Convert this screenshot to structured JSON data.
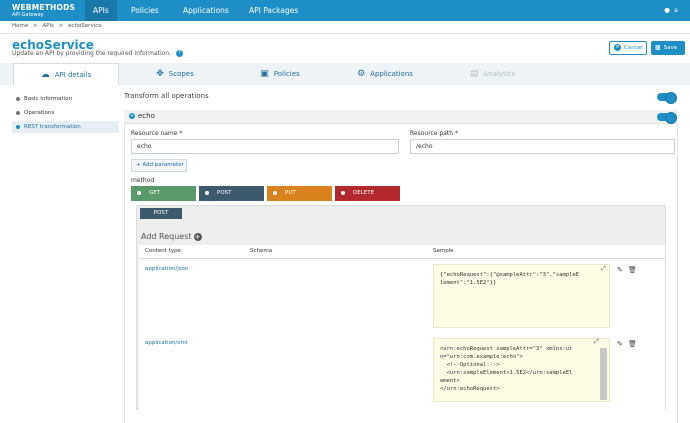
{
  "brand": {
    "name": "WEBMETHODS",
    "sub": "API Gateway"
  },
  "nav": [
    {
      "label": "APIs"
    },
    {
      "label": "Policies"
    },
    {
      "label": "Applications"
    },
    {
      "label": "API Packages"
    }
  ],
  "user": {
    "name": "a",
    "icon": "user-icon"
  },
  "breadcrumb": [
    "Home",
    ">",
    "APIs",
    ">",
    "echoService"
  ],
  "page": {
    "title": "echoService",
    "subtitle": "Update an API by providing the required information.",
    "cancel_label": "Cancel",
    "save_label": "Save"
  },
  "tabs": [
    {
      "label": "API details",
      "icon": "cloud-icon"
    },
    {
      "label": "Scopes",
      "icon": "scopes-icon"
    },
    {
      "label": "Policies",
      "icon": "lock-icon"
    },
    {
      "label": "Applications",
      "icon": "gears-icon"
    },
    {
      "label": "Analytics",
      "icon": "chart-icon"
    }
  ],
  "sidebar": [
    {
      "label": "Basic information"
    },
    {
      "label": "Operations"
    },
    {
      "label": "REST transformation"
    }
  ],
  "transform": {
    "label": "Transform all operations"
  },
  "resource": {
    "name": "echo",
    "name_label": "Resource name *",
    "name_value": "echo",
    "path_label": "Resource path *",
    "path_value": "/echo",
    "add_param_label": "Add parameter",
    "method_label": "method"
  },
  "methods": [
    {
      "label": "GET",
      "color": "#5a9a6a"
    },
    {
      "label": "POST",
      "color": "#3d5a6c"
    },
    {
      "label": "PUT",
      "color": "#d9811c"
    },
    {
      "label": "DELETE",
      "color": "#b3282d"
    }
  ],
  "request": {
    "active_method": "POST",
    "add_request_label": "Add Request",
    "columns": [
      "Content type",
      "Schema",
      "Sample"
    ],
    "rows": [
      {
        "content_type": "application/json",
        "sample": "{\"echoRequest\":{\"@sampleAttr\":\"3\",\"sampleE\nlement\":\"1.5E2\"}}"
      },
      {
        "content_type": "application/xml",
        "sample": "<urn:echoRequest sampleAttr=\"3\" xmlns:ur\nn=\"urn:com.example:echo\">\n  <!--Optional:-->\n  <urn:sampleElement>1.5E2</urn:sampleEl\nement>\n</urn:echoRequest>"
      }
    ]
  }
}
